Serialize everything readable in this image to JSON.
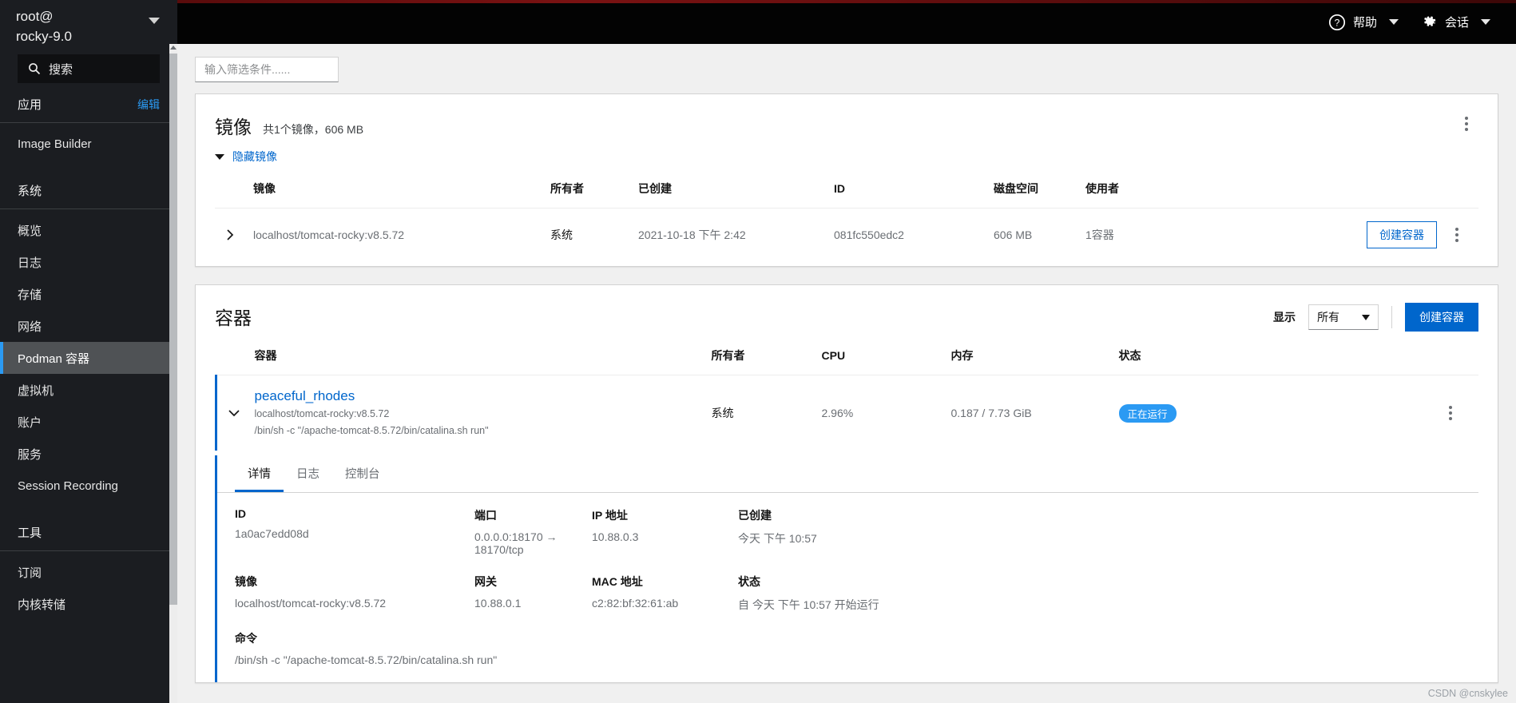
{
  "sidebar": {
    "host_user": "root@",
    "host_name": "rocky-9.0",
    "search_placeholder": "搜索",
    "search_icon": "search-icon",
    "groups": [
      {
        "title": "应用",
        "action": "编辑",
        "items": [
          "Image Builder"
        ]
      },
      {
        "title": "系统",
        "action": "",
        "items": [
          "概览",
          "日志",
          "存储",
          "网络",
          "Podman 容器",
          "虚拟机",
          "账户",
          "服务",
          "Session Recording"
        ]
      },
      {
        "title": "工具",
        "action": "",
        "items": [
          "订阅",
          "内核转储"
        ]
      }
    ],
    "active_item": "Podman 容器"
  },
  "topbar": {
    "help_icon": "help-circle-icon",
    "help_label": "帮助",
    "session_icon": "gear-icon",
    "session_label": "会话"
  },
  "filter": {
    "placeholder": "输入筛选条件......",
    "value": ""
  },
  "images_card": {
    "title": "镜像",
    "subtitle": "共1个镜像，606 MB",
    "toggle_label": "隐藏镜像",
    "kebab_icon": "kebab-menu-icon",
    "columns": [
      "镜像",
      "所有者",
      "已创建",
      "ID",
      "磁盘空间",
      "使用者"
    ],
    "rows": [
      {
        "expand_icon": "chevron-right-icon",
        "image": "localhost/tomcat-rocky:v8.5.72",
        "owner": "系统",
        "created": "2021-10-18 下午 2:42",
        "id": "081fc550edc2",
        "disk": "606 MB",
        "used_by": "1容器",
        "action_label": "创建容器",
        "kebab_icon": "kebab-menu-icon"
      }
    ]
  },
  "containers_card": {
    "title": "容器",
    "show_label": "显示",
    "filter_value": "所有",
    "create_label": "创建容器",
    "columns": [
      "容器",
      "所有者",
      "CPU",
      "内存",
      "状态"
    ],
    "row": {
      "expand_icon": "chevron-down-icon",
      "name": "peaceful_rhodes",
      "image": "localhost/tomcat-rocky:v8.5.72",
      "command": "/bin/sh -c \"/apache-tomcat-8.5.72/bin/catalina.sh run\"",
      "owner": "系统",
      "cpu": "2.96%",
      "memory": "0.187 / 7.73 GiB",
      "status_badge": "正在运行",
      "kebab_icon": "kebab-menu-icon"
    },
    "tabs": [
      {
        "label": "详情",
        "active": true
      },
      {
        "label": "日志",
        "active": false
      },
      {
        "label": "控制台",
        "active": false
      }
    ],
    "details": {
      "id_label": "ID",
      "id_value": "1a0ac7edd08d",
      "ports_label": "端口",
      "ports_value": "0.0.0.0:18170 → 18170/tcp",
      "ip_label": "IP 地址",
      "ip_value": "10.88.0.3",
      "created_label": "已创建",
      "created_value": "今天 下午 10:57",
      "image_label": "镜像",
      "image_value": "localhost/tomcat-rocky:v8.5.72",
      "gateway_label": "网关",
      "gateway_value": "10.88.0.1",
      "mac_label": "MAC 地址",
      "mac_value": "c2:82:bf:32:61:ab",
      "state_label": "状态",
      "state_value": "自 今天 下午 10:57 开始运行",
      "command_label": "命令",
      "command_value": "/bin/sh -c \"/apache-tomcat-8.5.72/bin/catalina.sh run\""
    }
  },
  "watermark": "CSDN @cnskylee",
  "colors": {
    "accent": "#06c",
    "badge": "#2b9af3",
    "sidebar_bg": "#1b1d21",
    "topbar_bg": "#030303"
  }
}
